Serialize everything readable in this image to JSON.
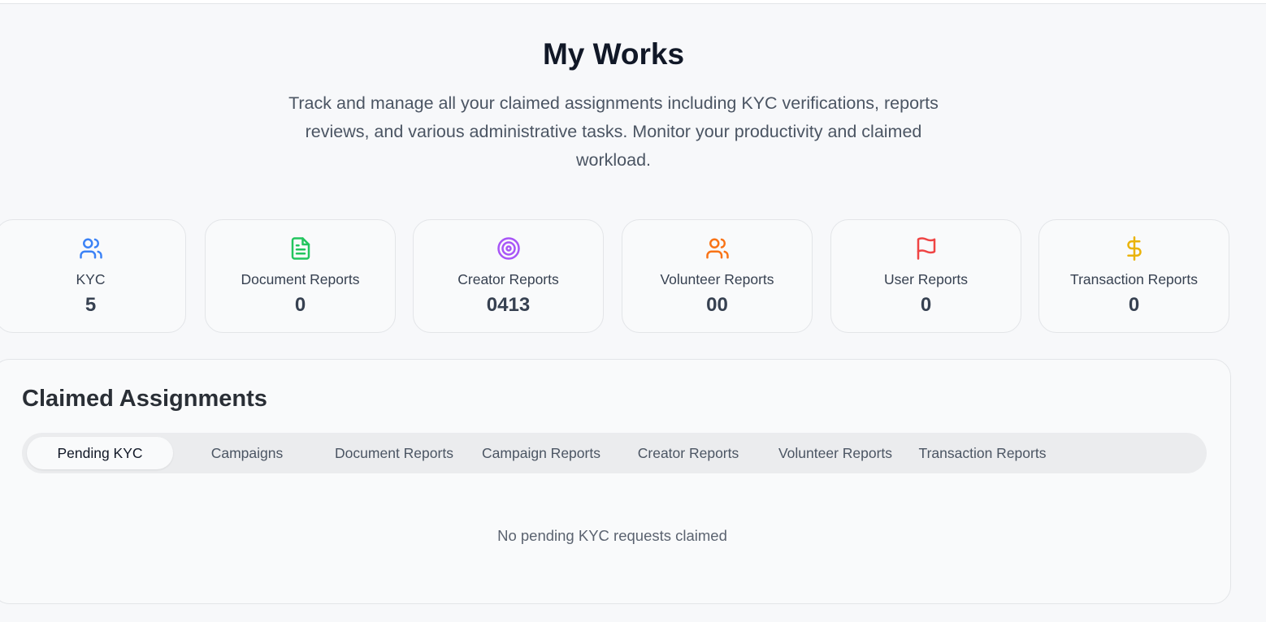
{
  "header": {
    "title": "My Works",
    "subtitle": "Track and manage all your claimed assignments including KYC verifications, reports reviews, and various administrative tasks. Monitor your productivity and claimed workload."
  },
  "stats": [
    {
      "label": "KYC",
      "value": "5",
      "icon": "users-icon",
      "color": "#3b82f6"
    },
    {
      "label": "Document Reports",
      "value": "0",
      "icon": "document-icon",
      "color": "#22c55e"
    },
    {
      "label": "Creator Reports",
      "value": "0413",
      "icon": "target-icon",
      "color": "#a855f7"
    },
    {
      "label": "Volunteer Reports",
      "value": "00",
      "icon": "users-icon",
      "color": "#f97316"
    },
    {
      "label": "User Reports",
      "value": "0",
      "icon": "flag-icon",
      "color": "#ef4444"
    },
    {
      "label": "Transaction Reports",
      "value": "0",
      "icon": "dollar-icon",
      "color": "#eab308"
    }
  ],
  "assignments": {
    "title": "Claimed Assignments",
    "tabs": [
      {
        "label": "Pending KYC",
        "active": true
      },
      {
        "label": "Campaigns",
        "active": false
      },
      {
        "label": "Document Reports",
        "active": false
      },
      {
        "label": "Campaign Reports",
        "active": false
      },
      {
        "label": "Creator Reports",
        "active": false
      },
      {
        "label": "Volunteer Reports",
        "active": false
      },
      {
        "label": "Transaction Reports",
        "active": false
      }
    ],
    "empty_message": "No pending KYC requests claimed"
  }
}
